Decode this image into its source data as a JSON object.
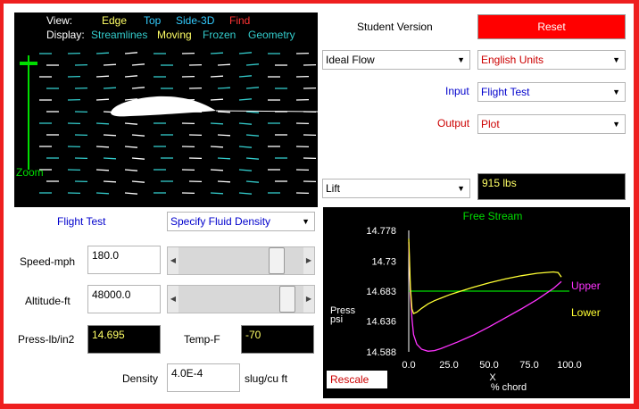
{
  "view_menu": {
    "view_label": "View:",
    "edge": "Edge",
    "top": "Top",
    "side3d": "Side-3D",
    "find": "Find",
    "display_label": "Display:",
    "streamlines": "Streamlines",
    "moving": "Moving",
    "frozen": "Frozen",
    "geometry": "Geometry",
    "zoom": "Zoom"
  },
  "header": {
    "version": "Student Version",
    "reset": "Reset"
  },
  "selectors": {
    "flow": "Ideal Flow",
    "units": "English Units",
    "input_label": "Input",
    "input_value": "Flight Test",
    "output_label": "Output",
    "output_value": "Plot",
    "result_select": "Lift",
    "result_value": "915 lbs"
  },
  "inputs": {
    "mode_label": "Flight Test",
    "mode_select": "Specify Fluid Density",
    "speed_label": "Speed-mph",
    "speed_value": "180.0",
    "speed_slider": 0.83,
    "altitude_label": "Altitude-ft",
    "altitude_value": "48000.0",
    "altitude_slider": 0.93,
    "press_label": "Press-lb/in2",
    "press_value": "14.695",
    "temp_label": "Temp-F",
    "temp_value": "-70",
    "density_label": "Density",
    "density_value": "4.0E-4",
    "density_unit": "slug/cu ft"
  },
  "chart_data": {
    "type": "line",
    "title": "Free Stream",
    "xlabel": "X",
    "xlabel2": "% chord",
    "ylabel": "Press",
    "ylabel2": "psi",
    "x_ticks": [
      "0.0",
      "25.0",
      "50.0",
      "75.0",
      "100.0"
    ],
    "y_ticks": [
      "14.778",
      "14.73",
      "14.683",
      "14.636",
      "14.588"
    ],
    "xlim": [
      0,
      100
    ],
    "ylim": [
      14.588,
      14.778
    ],
    "free_stream": 14.683,
    "series": [
      {
        "name": "Upper",
        "color": "#ff33ff",
        "x": [
          0,
          0.5,
          1,
          2,
          3,
          5,
          8,
          12,
          16,
          20,
          25,
          30,
          40,
          50,
          60,
          70,
          80,
          90,
          95
        ],
        "y": [
          14.76,
          14.72,
          14.683,
          14.64,
          14.615,
          14.6,
          14.592,
          14.589,
          14.59,
          14.593,
          14.598,
          14.603,
          14.614,
          14.627,
          14.641,
          14.655,
          14.67,
          14.687,
          14.698
        ]
      },
      {
        "name": "Lower",
        "color": "#ffff33",
        "x": [
          0,
          0.5,
          1,
          2,
          3,
          5,
          8,
          12,
          16,
          20,
          25,
          30,
          40,
          50,
          60,
          70,
          80,
          90,
          93,
          95
        ],
        "y": [
          14.765,
          14.73,
          14.69,
          14.655,
          14.648,
          14.65,
          14.656,
          14.663,
          14.668,
          14.672,
          14.677,
          14.681,
          14.689,
          14.696,
          14.702,
          14.707,
          14.711,
          14.713,
          14.712,
          14.705
        ]
      }
    ]
  },
  "plot": {
    "upper_label": "Upper",
    "lower_label": "Lower",
    "rescale": "Rescale"
  },
  "colors": {
    "frame": "#ee1f1f",
    "reset_button": "#ff0000",
    "edge": "#ffff66",
    "top": "#33ccff",
    "find": "#ff3333",
    "teal": "#33cccc",
    "zoom": "#00dd00",
    "input_blue": "#0000cc",
    "output_red": "#cc0000"
  }
}
